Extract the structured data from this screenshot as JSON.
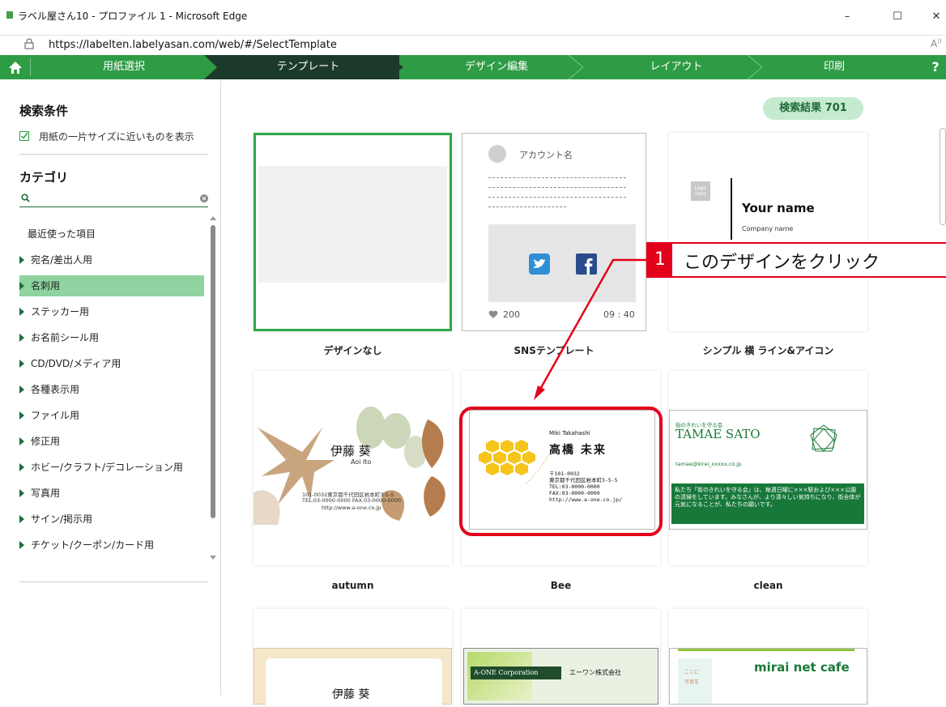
{
  "window": {
    "title": "ラベル屋さん10 - プロファイル 1 - Microsoft Edge",
    "url": "https://labelten.labelyasan.com/web/#/SelectTemplate",
    "controls": [
      "–",
      "☐",
      "✕"
    ]
  },
  "steps": {
    "items": [
      "用紙選択",
      "テンプレート",
      "デザイン編集",
      "レイアウト",
      "印刷"
    ],
    "active_index": 1,
    "help": "?"
  },
  "sidebar": {
    "search_heading": "検索条件",
    "paper_size_option": "用紙の一片サイズに近いものを表示",
    "category_heading": "カテゴリ",
    "search_placeholder": "",
    "recent": "最近使った項目",
    "categories": [
      "宛名/差出人用",
      "名刺用",
      "ステッカー用",
      "お名前シール用",
      "CD/DVD/メディア用",
      "各種表示用",
      "ファイル用",
      "修正用",
      "ホビー/クラフト/デコレーション用",
      "写真用",
      "サイン/掲示用",
      "チケット/クーポン/カード用"
    ],
    "selected_category": "名刺用"
  },
  "results": {
    "count_label": "検索結果 701"
  },
  "templates": [
    {
      "caption": "デザインなし"
    },
    {
      "caption": "SNSテンプレート",
      "account": "アカウント名",
      "likes": "200",
      "time": "09 : 40"
    },
    {
      "caption": "シンプル 横 ライン&アイコン",
      "logo": "Logo here",
      "name": "Your name",
      "company": "Company name"
    },
    {
      "caption": "autumn",
      "name": "伊藤 葵",
      "romaji": "Aoi Ito",
      "addr1": "101-0032東京都千代田区岩本町3-5-5",
      "addr2": "TEL.03-0000-0000  FAX.03-0000-0000",
      "addr3": "http://www.a-one.co.jp"
    },
    {
      "caption": "Bee",
      "romaji": "Miki Takahashi",
      "name": "高橋 未来",
      "zip": "〒101-0032",
      "addr": "東京都千代田区岩本町3-5-5",
      "tel": "TEL:03-0000-0000",
      "fax": "FAX:03-0000-0000",
      "url": "http://www.a-one.co.jp/"
    },
    {
      "caption": "clean",
      "tag": "街のきれいを守る会",
      "name": "TAMAE SATO",
      "email": "tamae@kirei_xxxxx.co.jp",
      "body": "私たち「街のきれいを守る会」は、毎週日曜に×××駅および×××公園の清掃をしています。みなさんが、より清々しい気持ちになり、街全体が元気になることが、私たちの願いです。"
    },
    {
      "caption": "",
      "name": "伊藤 葵"
    },
    {
      "caption": "",
      "corp": "A-ONE Corporation",
      "corp_jp": "エーワン株式会社"
    },
    {
      "caption": "",
      "shop": "mirai net cafe",
      "side1": "ここに",
      "side2": "写真を"
    }
  ],
  "callout": {
    "number": "1",
    "text": "このデザインをクリック"
  },
  "colors": {
    "step_bar": "#2e9c45",
    "step_active": "#1c3a2b",
    "selected_category": "#8fd3a0",
    "callout_red": "#e3001b"
  }
}
